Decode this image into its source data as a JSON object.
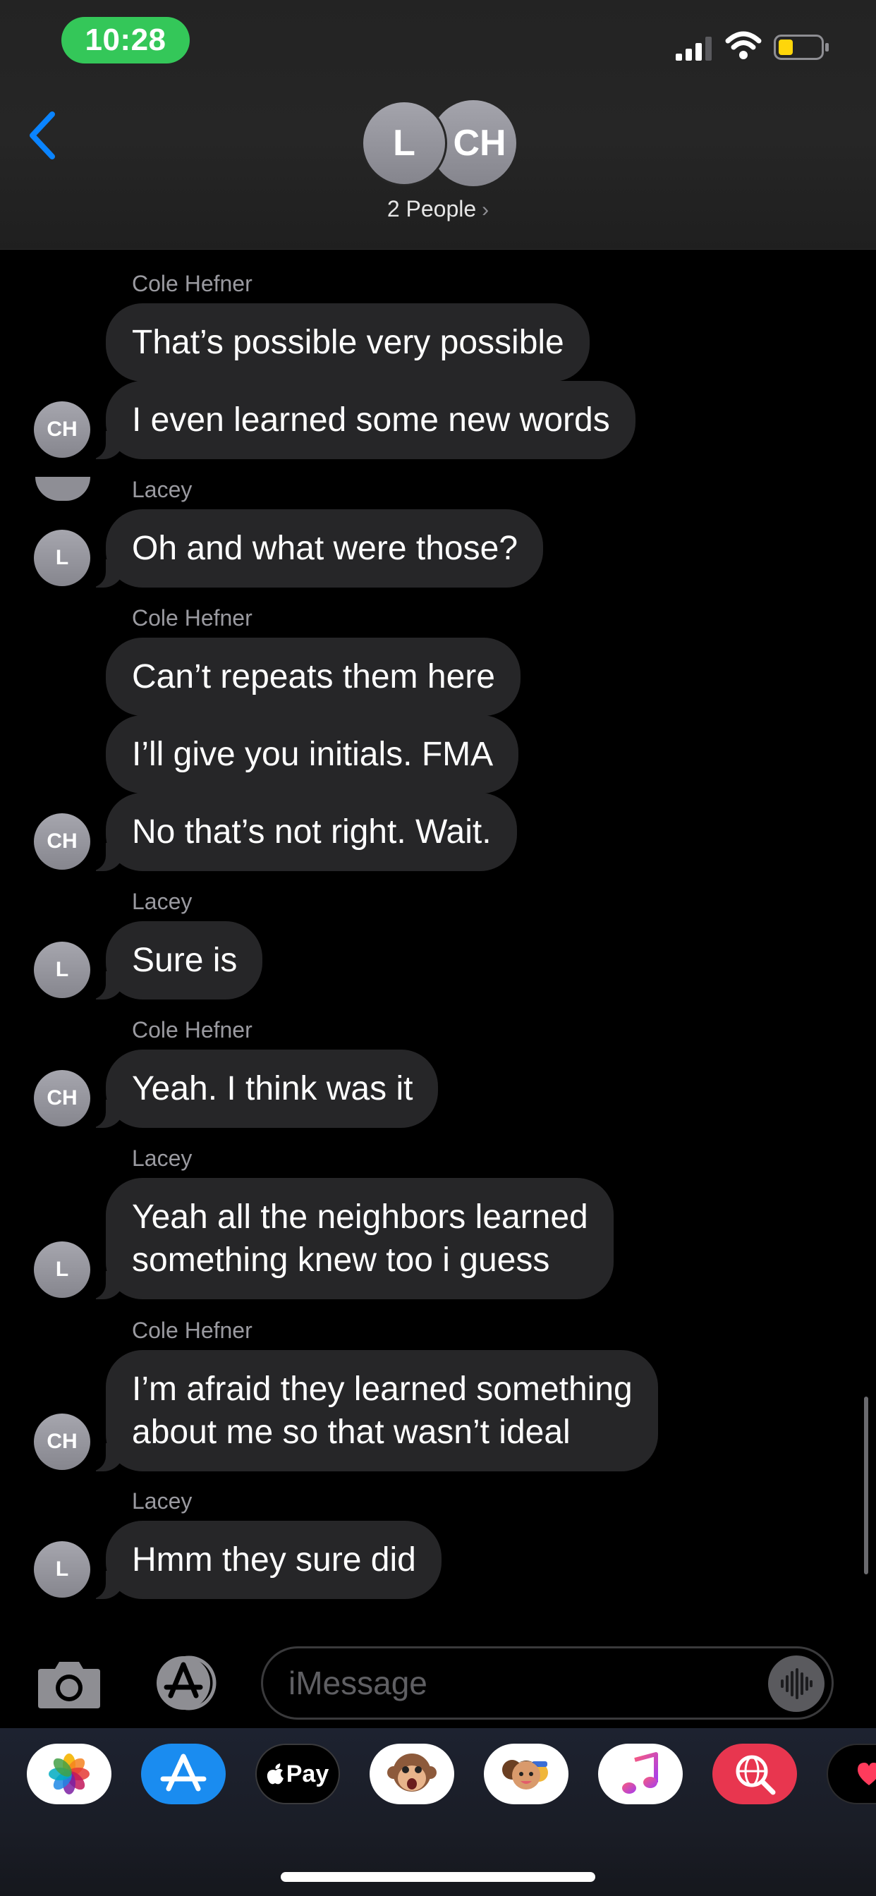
{
  "status_bar": {
    "time": "10:28"
  },
  "header": {
    "avatars": [
      {
        "initials": "L"
      },
      {
        "initials": "CH"
      }
    ],
    "people_label": "2 People",
    "chevron": "›"
  },
  "messages": [
    {
      "sender": "Cole Hefner",
      "avatar": "CH",
      "bubbles": [
        "That’s possible very possible",
        "I even learned some new words"
      ]
    },
    {
      "sender": "Lacey",
      "avatar": "L",
      "bubbles": [
        "Oh and what were those?"
      ]
    },
    {
      "sender": "Cole Hefner",
      "avatar": "CH",
      "bubbles": [
        "Can’t repeats them here",
        "I’ll give you initials. FMA",
        "No that’s not right. Wait."
      ]
    },
    {
      "sender": "Lacey",
      "avatar": "L",
      "bubbles": [
        "Sure is"
      ]
    },
    {
      "sender": "Cole Hefner",
      "avatar": "CH",
      "bubbles": [
        "Yeah. I think was it"
      ]
    },
    {
      "sender": "Lacey",
      "avatar": "L",
      "bubbles": [
        "Yeah all the neighbors learned",
        "something knew too i guess"
      ]
    },
    {
      "sender": "Cole Hefner",
      "avatar": "CH",
      "bubbles": [
        "I’m afraid they learned something",
        "about me so that wasn’t ideal"
      ]
    },
    {
      "sender": "Lacey",
      "avatar": "L",
      "bubbles": [
        "Hmm they sure did"
      ]
    }
  ],
  "input": {
    "placeholder": "iMessage"
  },
  "app_drawer": {
    "apps": [
      {
        "name": "photos-app-icon"
      },
      {
        "name": "app-store-app-icon"
      },
      {
        "name": "apple-pay-app-icon",
        "label": "Pay"
      },
      {
        "name": "animoji-app-icon"
      },
      {
        "name": "memoji-app-icon"
      },
      {
        "name": "music-app-icon"
      },
      {
        "name": "web-search-app-icon"
      },
      {
        "name": "digital-touch-app-icon"
      }
    ]
  },
  "colors": {
    "time_pill": "#34c759",
    "accent_blue": "#0a84ff",
    "bubble_received": "#262628",
    "background": "#000000"
  }
}
